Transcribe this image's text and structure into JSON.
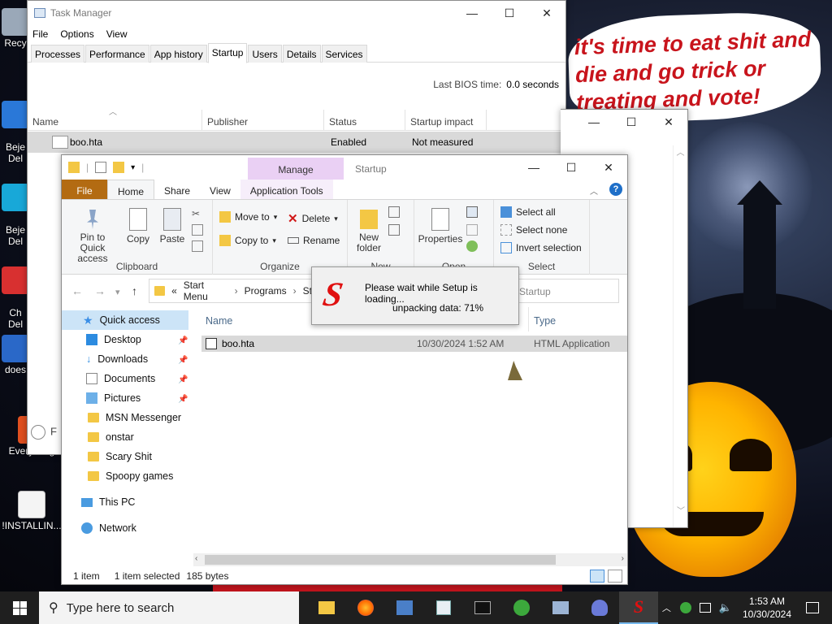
{
  "wallpaper": {
    "speech_text": "it's time to eat shit and die and go trick or treating and vote!"
  },
  "desktop_icons": [
    {
      "label": "Recy",
      "top": 0
    },
    {
      "label": "Beje\nDel"
    },
    {
      "label": "Beje\nDel"
    },
    {
      "label": "Ch\nDel"
    },
    {
      "label": "does"
    },
    {
      "label": "Everything"
    },
    {
      "label": "!INSTALLIN..."
    }
  ],
  "task_manager": {
    "title": "Task Manager",
    "menu": [
      "File",
      "Options",
      "View"
    ],
    "tabs": [
      "Processes",
      "Performance",
      "App history",
      "Startup",
      "Users",
      "Details",
      "Services"
    ],
    "active_tab": "Startup",
    "bios_label": "Last BIOS time:",
    "bios_value": "0.0 seconds",
    "columns": [
      "Name",
      "Publisher",
      "Status",
      "Startup impact"
    ],
    "rows": [
      {
        "name": "boo.hta",
        "publisher": "",
        "status": "Enabled",
        "impact": "Not measured"
      }
    ],
    "footer_partial": "F"
  },
  "explorer": {
    "title": "Startup",
    "manage_label": "Manage",
    "ribbon_tabs": [
      "File",
      "Home",
      "Share",
      "View",
      "Application Tools"
    ],
    "clipboard": {
      "pin": "Pin to Quick access",
      "copy": "Copy",
      "paste": "Paste",
      "label": "Clipboard"
    },
    "organize": {
      "move_to": "Move to",
      "copy_to": "Copy to",
      "delete": "Delete",
      "rename": "Rename",
      "label": "Organize"
    },
    "new": {
      "new_folder": "New folder",
      "label": "New"
    },
    "open": {
      "properties": "Properties",
      "label": "Open"
    },
    "select": {
      "select_all": "Select all",
      "select_none": "Select none",
      "invert": "Invert selection",
      "label": "Select"
    },
    "address": {
      "sep": "«",
      "parts": [
        "Start Menu",
        "Programs",
        "St"
      ]
    },
    "search_placeholder": "Startup",
    "nav": {
      "quick_access": "Quick access",
      "items": [
        "Desktop",
        "Downloads",
        "Documents",
        "Pictures",
        "MSN Messenger",
        "onstar",
        "Scary Shit",
        "Spoopy games"
      ],
      "this_pc": "This PC",
      "network": "Network"
    },
    "columns": {
      "name": "Name",
      "type": "Type"
    },
    "files": [
      {
        "name": "boo.hta",
        "date": "10/30/2024 1:52 AM",
        "type": "HTML Application"
      }
    ],
    "status": {
      "count": "1 item",
      "selected": "1 item selected",
      "size": "185 bytes"
    }
  },
  "setup_dialog": {
    "message": "Please wait while Setup is loading...",
    "progress_text": "unpacking data: 71%",
    "logo": "S"
  },
  "taskbar": {
    "search_placeholder": "Type here to search",
    "time": "1:53 AM",
    "date": "10/30/2024"
  }
}
